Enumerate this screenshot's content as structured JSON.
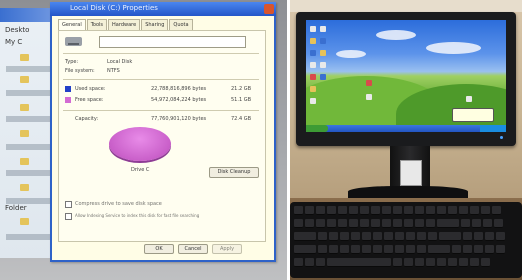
{
  "left_photo": {
    "explorer": {
      "labels": [
        "Deskto",
        "My C",
        "Folder"
      ]
    },
    "properties_dialog": {
      "title": "Local Disk (C:) Properties",
      "tabs": [
        "General",
        "Tools",
        "Hardware",
        "Sharing",
        "Quota"
      ],
      "active_tab": "General",
      "type_label": "Type:",
      "type_value": "Local Disk",
      "fs_label": "File system:",
      "fs_value": "NTFS",
      "used_label": "Used space:",
      "used_bytes": "22,788,816,896 bytes",
      "used_gb": "21.2 GB",
      "free_label": "Free space:",
      "free_bytes": "54,972,084,224 bytes",
      "free_gb": "51.1 GB",
      "capacity_label": "Capacity:",
      "capacity_bytes": "77,760,901,120 bytes",
      "capacity_gb": "72.4 GB",
      "drive_label": "Drive C",
      "cleanup_button": "Disk Cleanup",
      "compress_label": "Compress drive to save disk space",
      "index_label": "Allow Indexing Service to index this disk for fast file searching",
      "ok_button": "OK",
      "cancel_button": "Cancel",
      "apply_button": "Apply",
      "colors": {
        "used": "#2340c8",
        "free": "#d36bd3",
        "title_bar": "#2e62c8"
      },
      "disk_usage": {
        "used_gb": 21.2,
        "free_gb": 51.1
      }
    }
  },
  "right_photo": {
    "monitor": {
      "wallpaper": "Bliss (blue sky, green hills)",
      "taskbar_color": "#2a5fc8"
    }
  }
}
